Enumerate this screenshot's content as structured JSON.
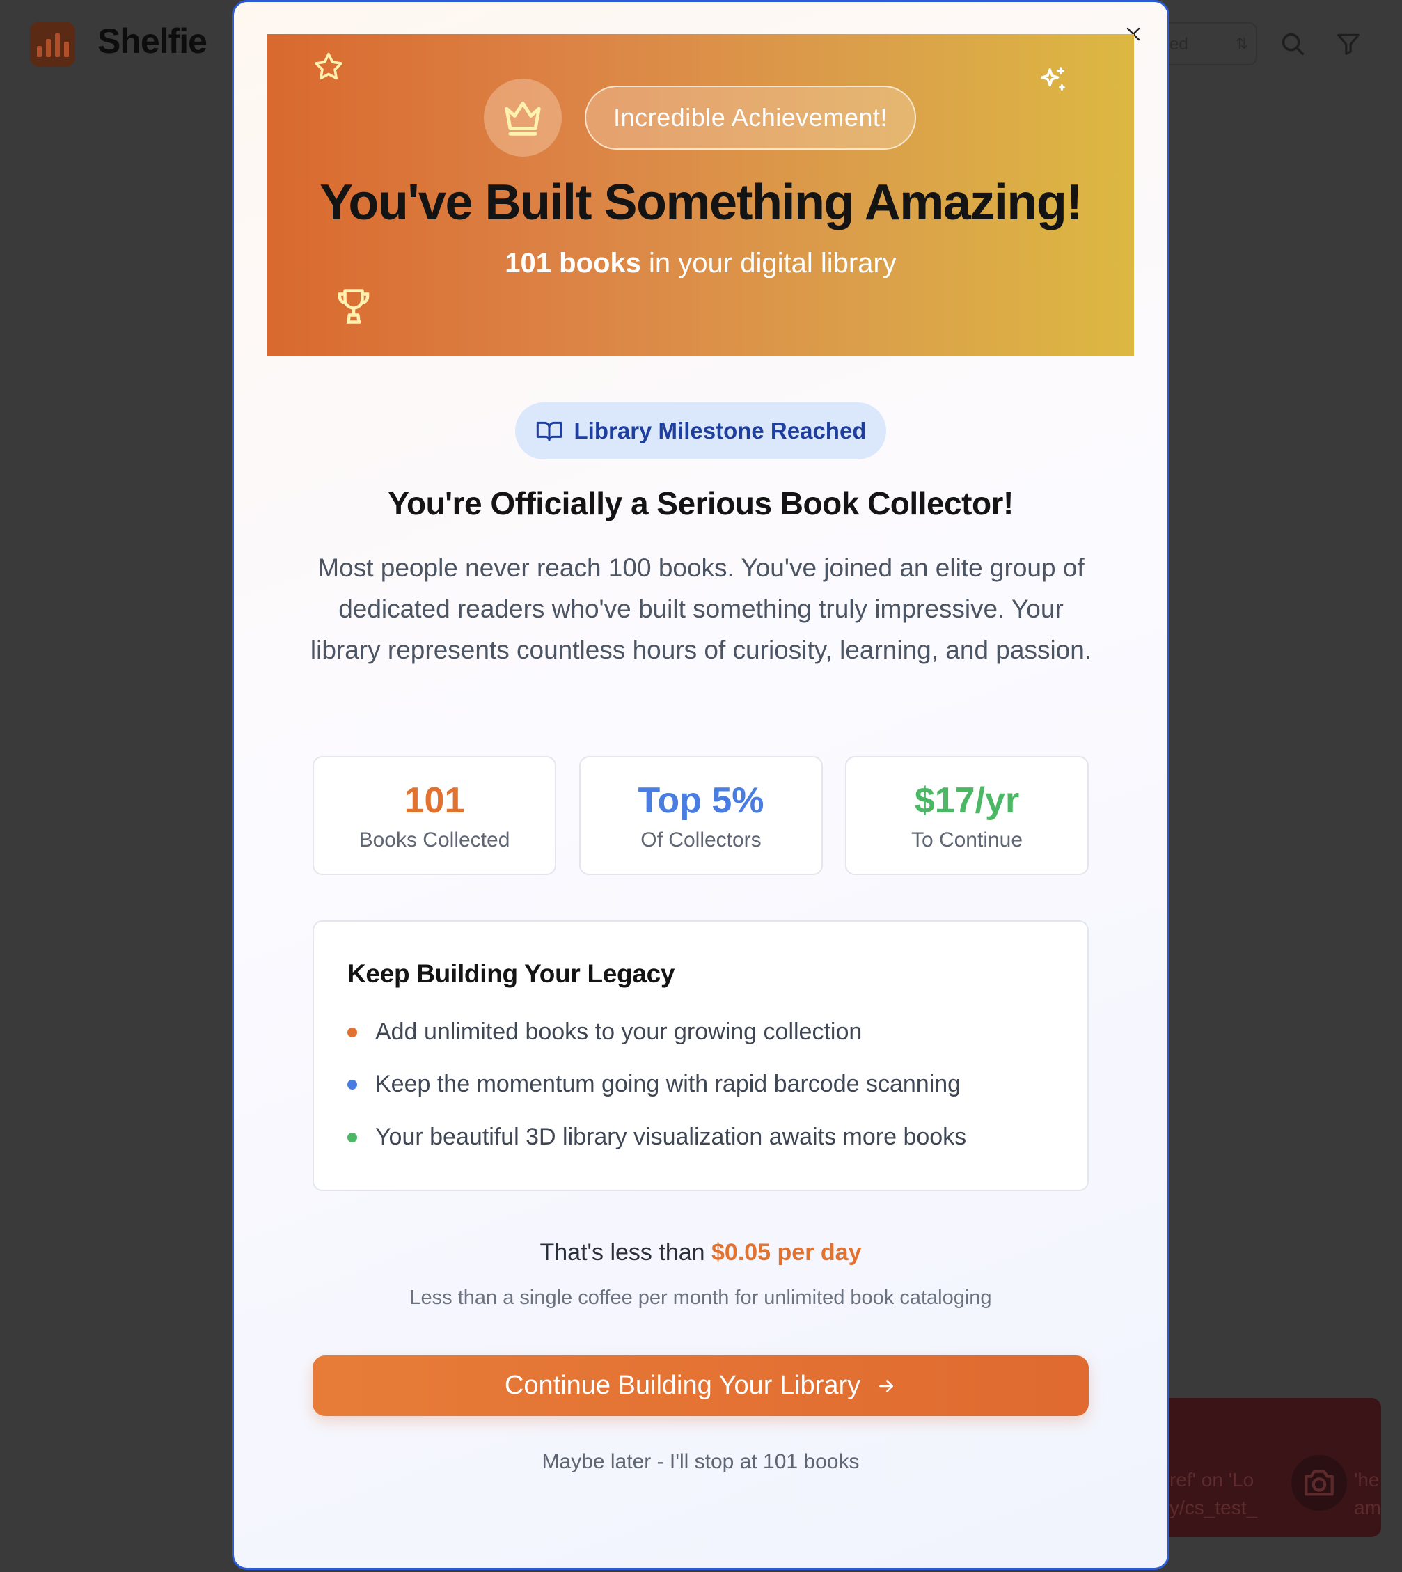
{
  "app": {
    "name": "Shelfie",
    "header_pill_text": "ed",
    "sort_glyph": "⇅"
  },
  "toast": {
    "line1_left": "ref' on 'Lo",
    "line2_left": "y/cs_test_",
    "line1_right": "'he",
    "line2_right": "am"
  },
  "modal": {
    "hero": {
      "badge": "Incredible Achievement!",
      "title": "You've Built Something Amazing!",
      "subtitle_bold": "101 books",
      "subtitle_rest": " in your digital library"
    },
    "milestone_badge": "Library Milestone Reached",
    "heading": "You're Officially a Serious Book Collector!",
    "description": "Most people never reach 100 books. You've joined an elite group of dedicated readers who've built something truly impressive. Your library represents countless hours of curiosity, learning, and passion.",
    "stats": [
      {
        "value": "101",
        "label": "Books Collected",
        "color": "#e2722f"
      },
      {
        "value": "Top 5%",
        "label": "Of Collectors",
        "color": "#4a7de2"
      },
      {
        "value": "$17/yr",
        "label": "To Continue",
        "color": "#4cb866"
      }
    ],
    "benefits": {
      "title": "Keep Building Your Legacy",
      "items": [
        {
          "text": "Add unlimited books to your growing collection",
          "color": "#e2722f"
        },
        {
          "text": "Keep the momentum going with rapid barcode scanning",
          "color": "#4a7de2"
        },
        {
          "text": "Your beautiful 3D library visualization awaits more books",
          "color": "#4cb866"
        }
      ]
    },
    "price_prefix": "That's less than ",
    "price_highlight": "$0.05 per day",
    "price_note": "Less than a single coffee per month for unlimited book cataloging",
    "cta_label": "Continue Building Your Library",
    "dismiss_label": "Maybe later - I'll stop at 101 books"
  }
}
